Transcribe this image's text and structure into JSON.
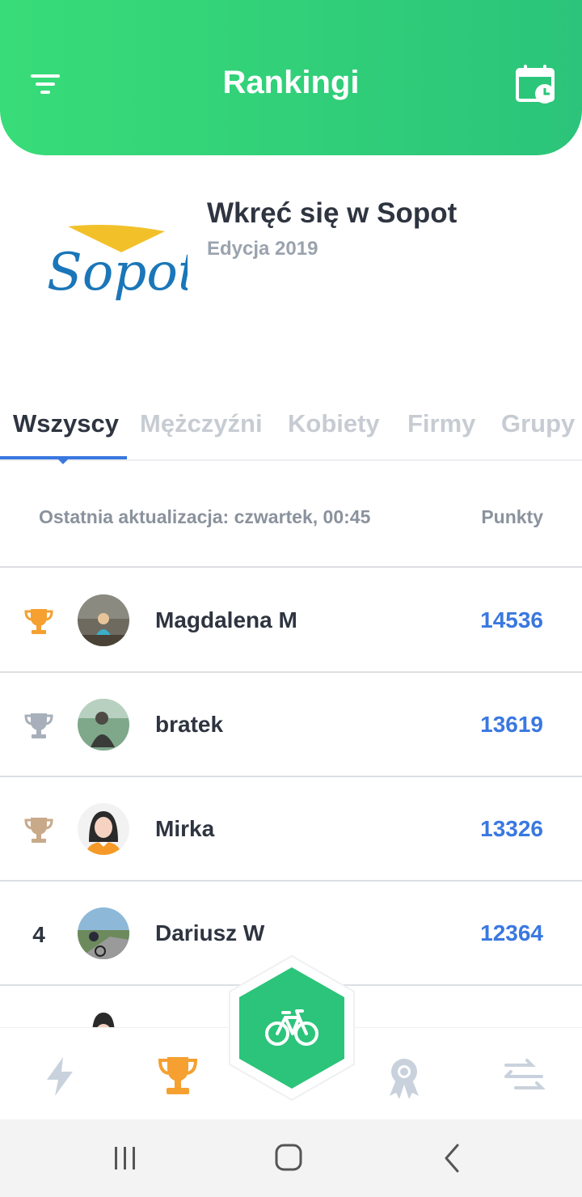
{
  "header": {
    "title": "Rankingi"
  },
  "event": {
    "logo_text": "Sopot",
    "name": "Wkręć się w Sopot",
    "edition": "Edycja 2019"
  },
  "tabs": [
    {
      "label": "Wszyscy",
      "active": true
    },
    {
      "label": "Mężczyźni",
      "active": false
    },
    {
      "label": "Kobiety",
      "active": false
    },
    {
      "label": "Firmy",
      "active": false
    },
    {
      "label": "Grupy",
      "active": false
    }
  ],
  "list": {
    "last_update": "Ostatnia aktualizacja: czwartek, 00:45",
    "points_header": "Punkty",
    "rows": [
      {
        "rank": "",
        "rank_icon": "gold-trophy-icon",
        "name": "Magdalena M",
        "points": "14536"
      },
      {
        "rank": "",
        "rank_icon": "silver-trophy-icon",
        "name": "bratek",
        "points": "13619"
      },
      {
        "rank": "",
        "rank_icon": "bronze-trophy-icon",
        "name": "Mirka",
        "points": "13326"
      },
      {
        "rank": "4",
        "rank_icon": "",
        "name": "Dariusz W",
        "points": "12364"
      }
    ]
  },
  "bottom_nav": [
    "lightning-icon",
    "trophy-icon",
    "bike-icon",
    "medal-icon",
    "arrows-icon"
  ],
  "colors": {
    "header_green": "#2bc47a",
    "accent_blue": "#3a78e0",
    "gold": "#f5a030",
    "silver": "#a7b0ba",
    "bronze": "#c8aa8a"
  }
}
